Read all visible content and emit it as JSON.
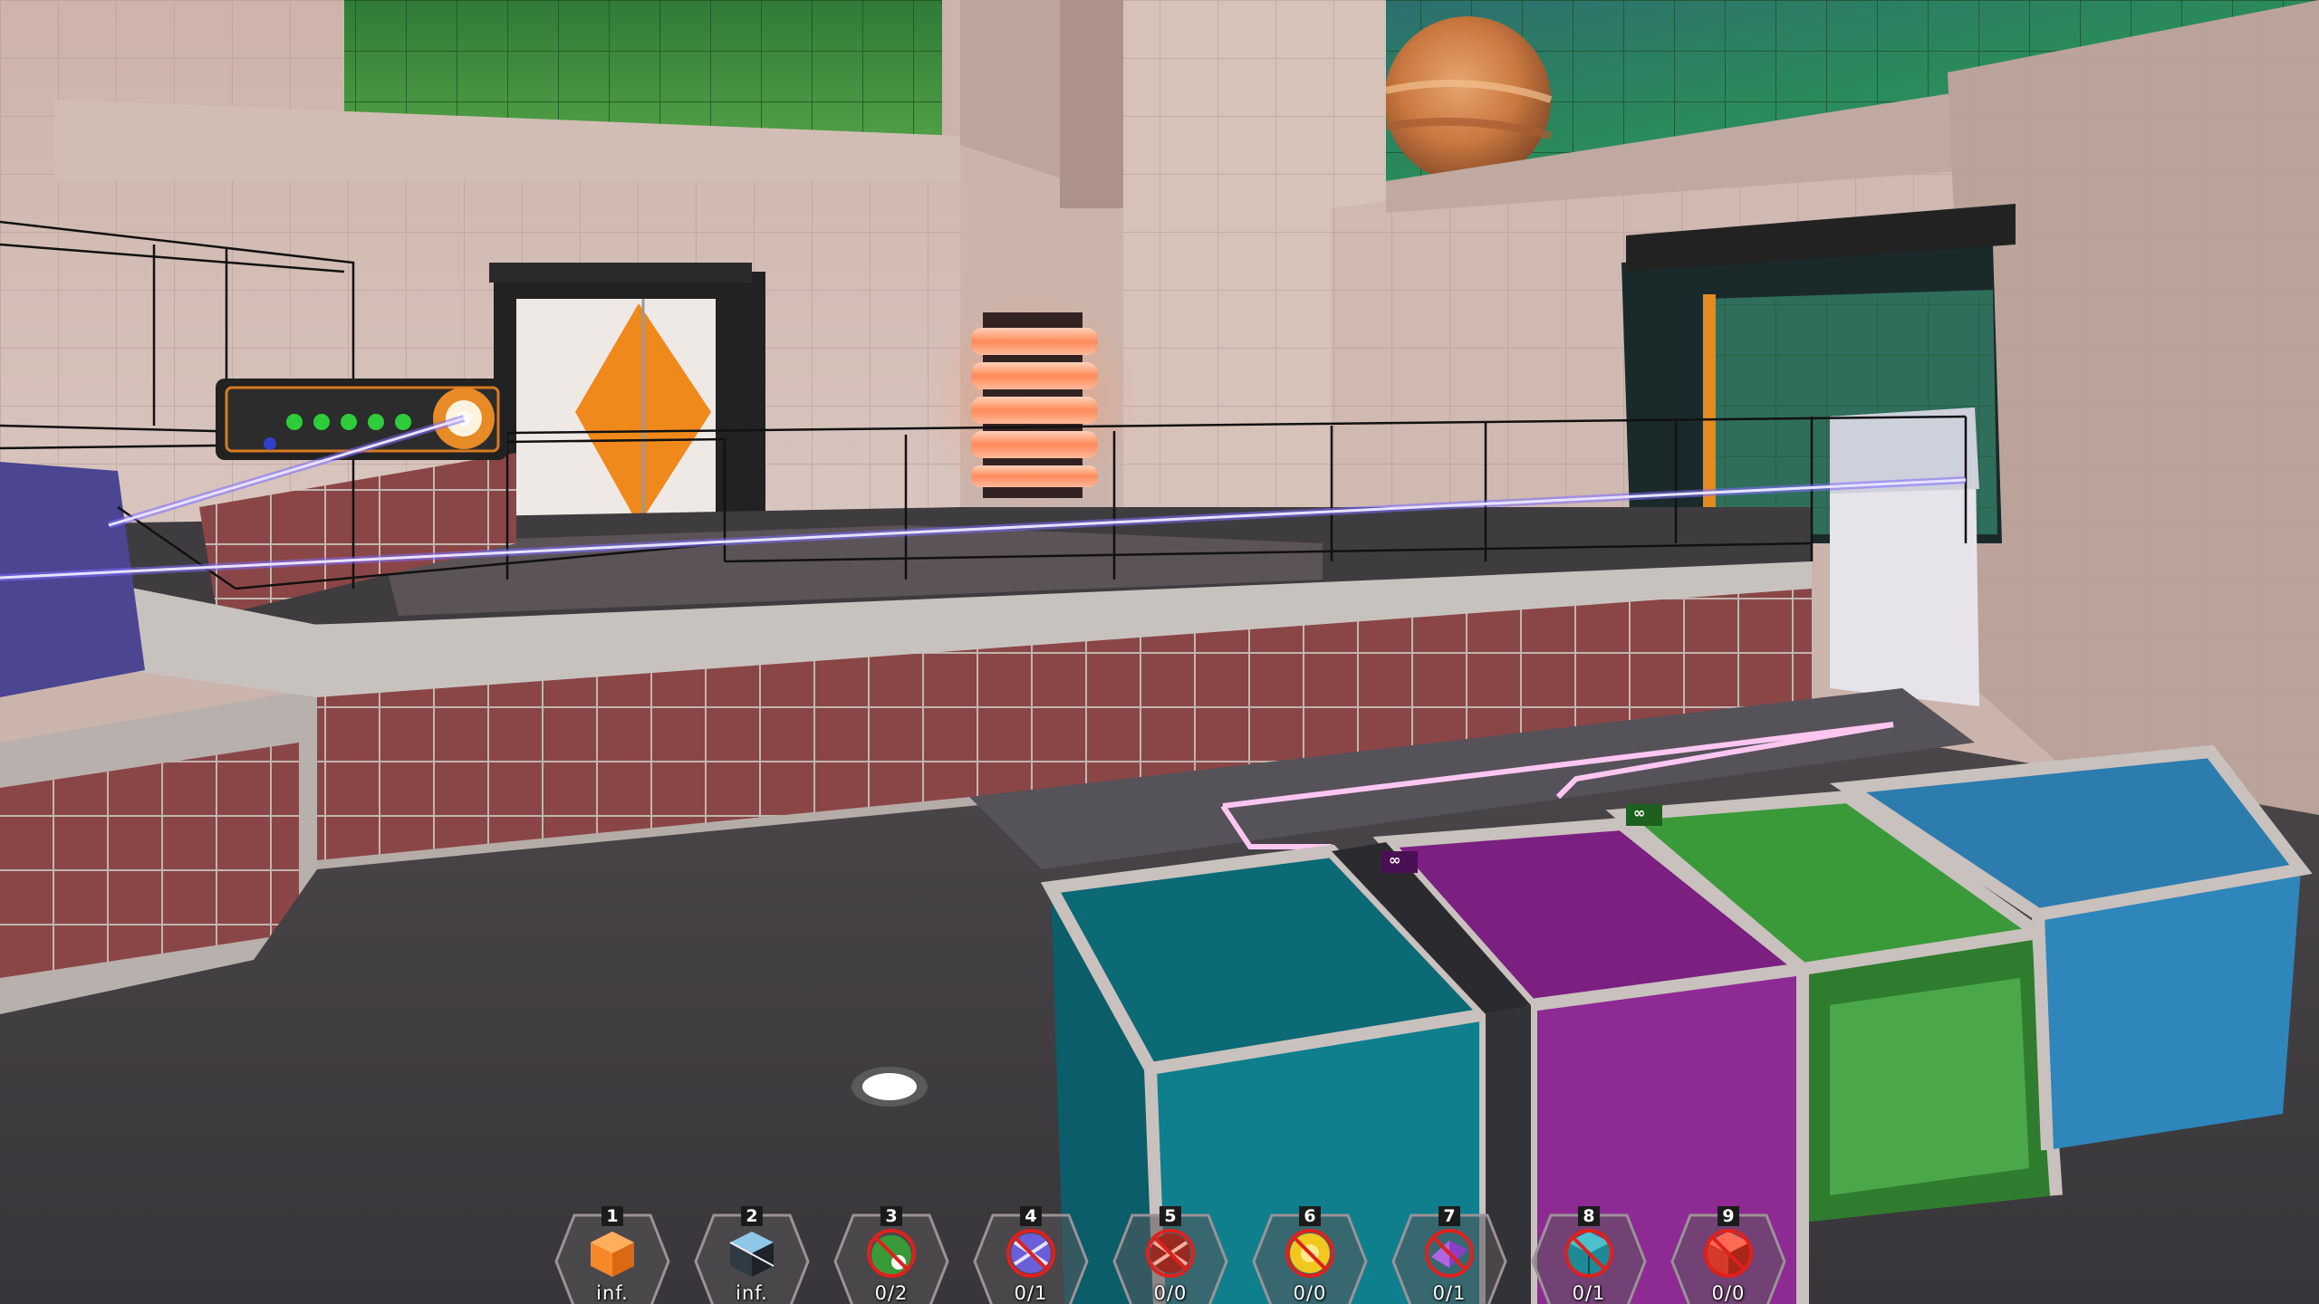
{
  "hud": {
    "hotbar": [
      {
        "key": "1",
        "count": "inf.",
        "icon": "orange-cube-icon",
        "disabled": false
      },
      {
        "key": "2",
        "count": "inf.",
        "icon": "glass-cube-icon",
        "disabled": false
      },
      {
        "key": "3",
        "count": "0/2",
        "icon": "green-bomb-icon",
        "disabled": true
      },
      {
        "key": "4",
        "count": "0/1",
        "icon": "blue-crossbeam-icon",
        "disabled": true
      },
      {
        "key": "5",
        "count": "0/0",
        "icon": "red-crossbeam-icon",
        "disabled": true
      },
      {
        "key": "6",
        "count": "0/0",
        "icon": "yellow-orb-icon",
        "disabled": true
      },
      {
        "key": "7",
        "count": "0/1",
        "icon": "purple-gem-icon",
        "disabled": true
      },
      {
        "key": "8",
        "count": "0/1",
        "icon": "teal-cube-icon",
        "disabled": true
      },
      {
        "key": "9",
        "count": "0/0",
        "icon": "red-cube-icon",
        "disabled": true
      }
    ],
    "box_tags": {
      "purple": "∞",
      "green": "∞"
    }
  },
  "colors": {
    "wall": "#d8c3bb",
    "floor": "#444347",
    "tile_red": "#8b4545",
    "laser": "#8f80ff",
    "teal_box": "#0e7d8a",
    "purple_box": "#7a1f7f",
    "green_box": "#3a9a3a",
    "blue_box": "#2d7fb0",
    "door_orange": "#ee8a1e"
  }
}
